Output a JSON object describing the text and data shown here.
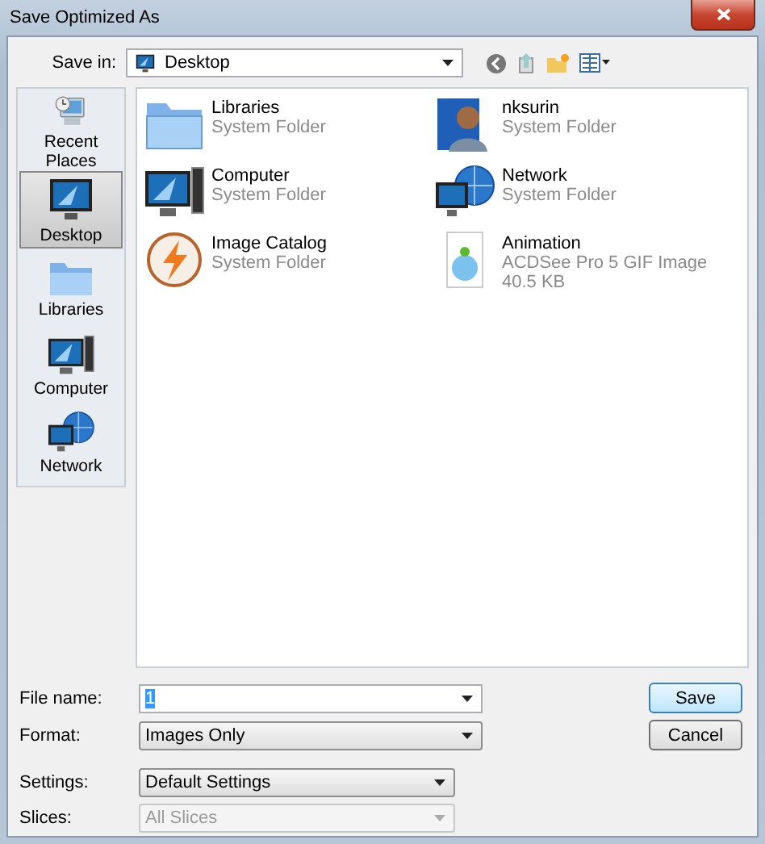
{
  "window": {
    "title": "Save Optimized As"
  },
  "save_in": {
    "label": "Save in:",
    "value": "Desktop"
  },
  "places": [
    {
      "kind": "recent",
      "label": "Recent Places",
      "selected": false
    },
    {
      "kind": "desktop",
      "label": "Desktop",
      "selected": true
    },
    {
      "kind": "libraries",
      "label": "Libraries",
      "selected": false
    },
    {
      "kind": "computer",
      "label": "Computer",
      "selected": false
    },
    {
      "kind": "network",
      "label": "Network",
      "selected": false
    }
  ],
  "files": [
    {
      "kind": "folder",
      "name": "Libraries",
      "details": [
        "System Folder"
      ]
    },
    {
      "kind": "user",
      "name": "nksurin",
      "details": [
        "System Folder"
      ]
    },
    {
      "kind": "computer",
      "name": "Computer",
      "details": [
        "System Folder"
      ]
    },
    {
      "kind": "network",
      "name": "Network",
      "details": [
        "System Folder"
      ]
    },
    {
      "kind": "app",
      "name": "Image Catalog",
      "details": [
        "System Folder"
      ]
    },
    {
      "kind": "image",
      "name": "Animation",
      "details": [
        "ACDSee Pro 5 GIF Image",
        "40.5 KB"
      ]
    }
  ],
  "fields": [
    {
      "kind": "input",
      "label": "File name:",
      "value": "1",
      "value_selected": true,
      "disabled": false
    },
    {
      "kind": "dropdown",
      "label": "Format:",
      "value": "Images Only",
      "disabled": false
    },
    {
      "kind": "dropdown",
      "label": "Settings:",
      "value": "Default Settings",
      "disabled": false
    },
    {
      "kind": "dropdown",
      "label": "Slices:",
      "value": "All Slices",
      "disabled": true
    }
  ],
  "buttons": [
    {
      "label": "Save",
      "default": true
    },
    {
      "label": "Cancel",
      "default": false
    }
  ]
}
